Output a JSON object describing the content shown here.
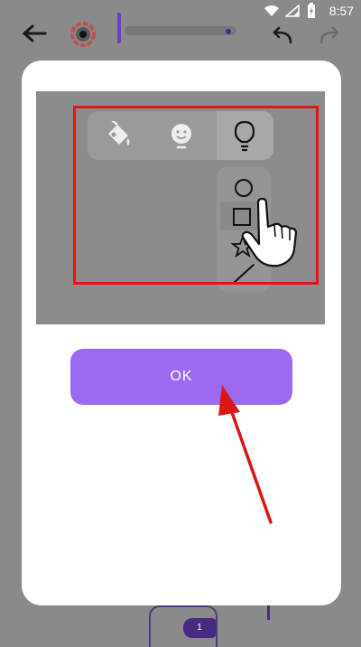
{
  "status_bar": {
    "time": "8:57"
  },
  "dialog": {
    "ok_label": "OK"
  },
  "bottom_bar": {
    "page_number": "1"
  },
  "colors": {
    "accent": "#9b6af0",
    "highlight": "#e01616",
    "overlay": "#8a8a8a"
  }
}
